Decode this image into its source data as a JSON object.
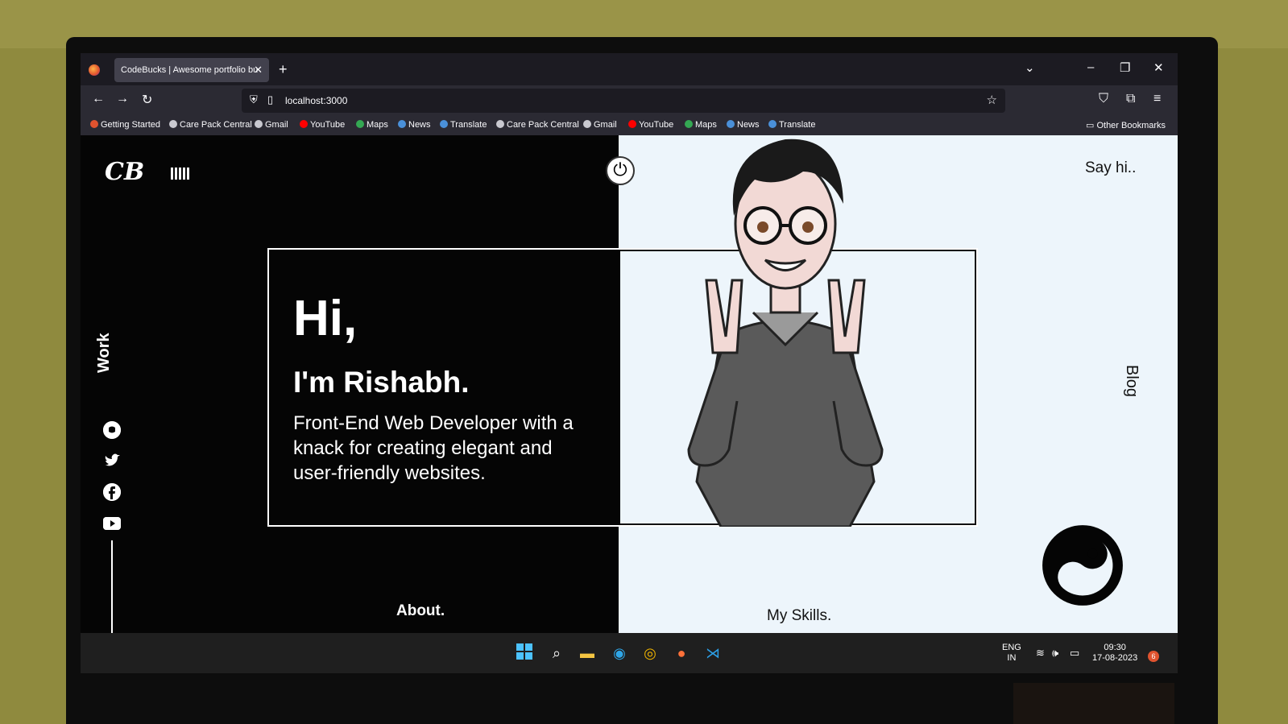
{
  "browser": {
    "tab_title": "CodeBucks | Awesome portfolio bu",
    "tab_close": "✕",
    "new_tab": "+",
    "url": "localhost:3000",
    "window_controls": {
      "list_all_tabs": "⌄",
      "minimize": "–",
      "restore": "❐",
      "close": "✕"
    },
    "nav": {
      "back": "←",
      "forward": "→",
      "reload": "↻",
      "star": "☆",
      "pocket": "⛉",
      "extensions": "⧉",
      "menu": "≡"
    },
    "bookmarks": [
      {
        "label": "Getting Started",
        "color": "#e0532f"
      },
      {
        "label": "Care Pack Central",
        "color": "#c9c9d0"
      },
      {
        "label": "Gmail",
        "color": "#c9c9d0"
      },
      {
        "label": "YouTube",
        "color": "#ff0000"
      },
      {
        "label": "Maps",
        "color": "#34a853"
      },
      {
        "label": "News",
        "color": "#4a90d9"
      },
      {
        "label": "Translate",
        "color": "#4a90d9"
      },
      {
        "label": "Care Pack Central",
        "color": "#c9c9d0"
      },
      {
        "label": "Gmail",
        "color": "#c9c9d0"
      },
      {
        "label": "YouTube",
        "color": "#ff0000"
      },
      {
        "label": "Maps",
        "color": "#34a853"
      },
      {
        "label": "News",
        "color": "#4a90d9"
      },
      {
        "label": "Translate",
        "color": "#4a90d9"
      }
    ],
    "other_bookmarks": "Other Bookmarks"
  },
  "site": {
    "logo": "CB",
    "say_hi": "Say hi..",
    "work": "Work",
    "blog": "Blog",
    "about": "About.",
    "skills": "My Skills.",
    "hero": {
      "hi": "Hi,",
      "name": "I'm Rishabh.",
      "tagline": "Front-End Web Developer with a knack for creating elegant and user-friendly websites."
    },
    "social_icons": [
      "github-icon",
      "twitter-icon",
      "facebook-icon",
      "youtube-icon"
    ]
  },
  "taskbar": {
    "apps": [
      "windows-start-icon",
      "search-icon",
      "file-explorer-icon",
      "edge-icon",
      "chrome-icon",
      "firefox-icon",
      "vscode-icon"
    ],
    "lang": "ENG",
    "region": "IN",
    "time": "09:30",
    "date": "17-08-2023",
    "notifications": "6"
  },
  "colors": {
    "dark": "#050505",
    "light": "#edf5fb",
    "browser_bg": "#1c1b22"
  }
}
